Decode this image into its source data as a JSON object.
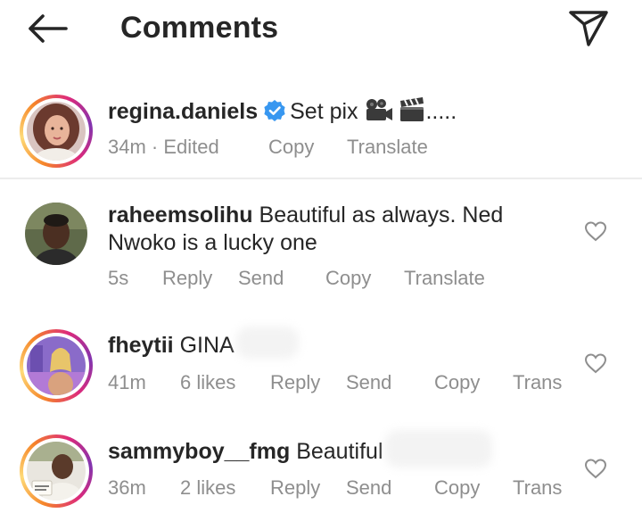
{
  "header": {
    "title": "Comments"
  },
  "caption": {
    "username": "regina.daniels",
    "text": "Set pix",
    "trailing": ".....",
    "time": "34m · Edited",
    "actions": {
      "copy": "Copy",
      "translate": "Translate"
    }
  },
  "comments": [
    {
      "username": "raheemsolihu",
      "text_line1": "Beautiful as always. Ned",
      "text_line2": "Nwoko is a lucky one",
      "time": "5s",
      "likes": "",
      "actions": {
        "reply": "Reply",
        "send": "Send",
        "copy": "Copy",
        "translate": "Translate"
      }
    },
    {
      "username": "fheytii",
      "text": "GINA",
      "time": "41m",
      "likes": "6 likes",
      "actions": {
        "reply": "Reply",
        "send": "Send",
        "copy": "Copy",
        "translate": "Trans"
      }
    },
    {
      "username": "sammyboy__fmg",
      "text": "Beautiful",
      "time": "36m",
      "likes": "2 likes",
      "actions": {
        "reply": "Reply",
        "send": "Send",
        "copy": "Copy",
        "translate": "Trans"
      }
    }
  ],
  "colors": {
    "text": "#262626",
    "meta": "#8e8e8e",
    "verified": "#3897f0",
    "divider": "#ececec"
  }
}
